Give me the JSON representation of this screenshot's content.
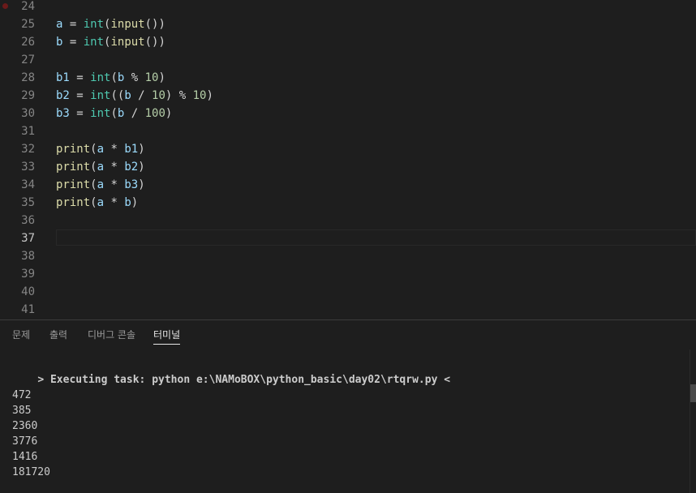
{
  "editor": {
    "lines": [
      {
        "num": "24",
        "tokens": []
      },
      {
        "num": "25",
        "tokens": [
          [
            "var",
            "a"
          ],
          [
            "op",
            " = "
          ],
          [
            "type",
            "int"
          ],
          [
            "op",
            "("
          ],
          [
            "fn",
            "input"
          ],
          [
            "op",
            "())"
          ]
        ]
      },
      {
        "num": "26",
        "tokens": [
          [
            "var",
            "b"
          ],
          [
            "op",
            " = "
          ],
          [
            "type",
            "int"
          ],
          [
            "op",
            "("
          ],
          [
            "fn",
            "input"
          ],
          [
            "op",
            "())"
          ]
        ]
      },
      {
        "num": "27",
        "tokens": []
      },
      {
        "num": "28",
        "tokens": [
          [
            "var",
            "b1"
          ],
          [
            "op",
            " = "
          ],
          [
            "type",
            "int"
          ],
          [
            "op",
            "("
          ],
          [
            "var",
            "b"
          ],
          [
            "op",
            " % "
          ],
          [
            "num",
            "10"
          ],
          [
            "op",
            ")"
          ]
        ]
      },
      {
        "num": "29",
        "tokens": [
          [
            "var",
            "b2"
          ],
          [
            "op",
            " = "
          ],
          [
            "type",
            "int"
          ],
          [
            "op",
            "(("
          ],
          [
            "var",
            "b"
          ],
          [
            "op",
            " / "
          ],
          [
            "num",
            "10"
          ],
          [
            "op",
            ") % "
          ],
          [
            "num",
            "10"
          ],
          [
            "op",
            ")"
          ]
        ]
      },
      {
        "num": "30",
        "tokens": [
          [
            "var",
            "b3"
          ],
          [
            "op",
            " = "
          ],
          [
            "type",
            "int"
          ],
          [
            "op",
            "("
          ],
          [
            "var",
            "b"
          ],
          [
            "op",
            " / "
          ],
          [
            "num",
            "100"
          ],
          [
            "op",
            ")"
          ]
        ]
      },
      {
        "num": "31",
        "tokens": []
      },
      {
        "num": "32",
        "tokens": [
          [
            "fn",
            "print"
          ],
          [
            "op",
            "("
          ],
          [
            "var",
            "a"
          ],
          [
            "op",
            " * "
          ],
          [
            "var",
            "b1"
          ],
          [
            "op",
            ")"
          ]
        ]
      },
      {
        "num": "33",
        "tokens": [
          [
            "fn",
            "print"
          ],
          [
            "op",
            "("
          ],
          [
            "var",
            "a"
          ],
          [
            "op",
            " * "
          ],
          [
            "var",
            "b2"
          ],
          [
            "op",
            ")"
          ]
        ]
      },
      {
        "num": "34",
        "tokens": [
          [
            "fn",
            "print"
          ],
          [
            "op",
            "("
          ],
          [
            "var",
            "a"
          ],
          [
            "op",
            " * "
          ],
          [
            "var",
            "b3"
          ],
          [
            "op",
            ")"
          ]
        ]
      },
      {
        "num": "35",
        "tokens": [
          [
            "fn",
            "print"
          ],
          [
            "op",
            "("
          ],
          [
            "var",
            "a"
          ],
          [
            "op",
            " * "
          ],
          [
            "var",
            "b"
          ],
          [
            "op",
            ")"
          ]
        ]
      },
      {
        "num": "36",
        "tokens": []
      },
      {
        "num": "37",
        "tokens": [],
        "active": true
      },
      {
        "num": "38",
        "tokens": []
      },
      {
        "num": "39",
        "tokens": []
      },
      {
        "num": "40",
        "tokens": []
      },
      {
        "num": "41",
        "tokens": []
      }
    ]
  },
  "panel": {
    "tabs": [
      {
        "label": "문제",
        "active": false
      },
      {
        "label": "출력",
        "active": false
      },
      {
        "label": "디버그 콘솔",
        "active": false
      },
      {
        "label": "터미널",
        "active": true
      }
    ],
    "terminal": {
      "command": "> Executing task: python e:\\NAMoBOX\\python_basic\\day02\\rtqrw.py <",
      "output": [
        "472",
        "385",
        "2360",
        "3776",
        "1416",
        "181720"
      ]
    }
  }
}
